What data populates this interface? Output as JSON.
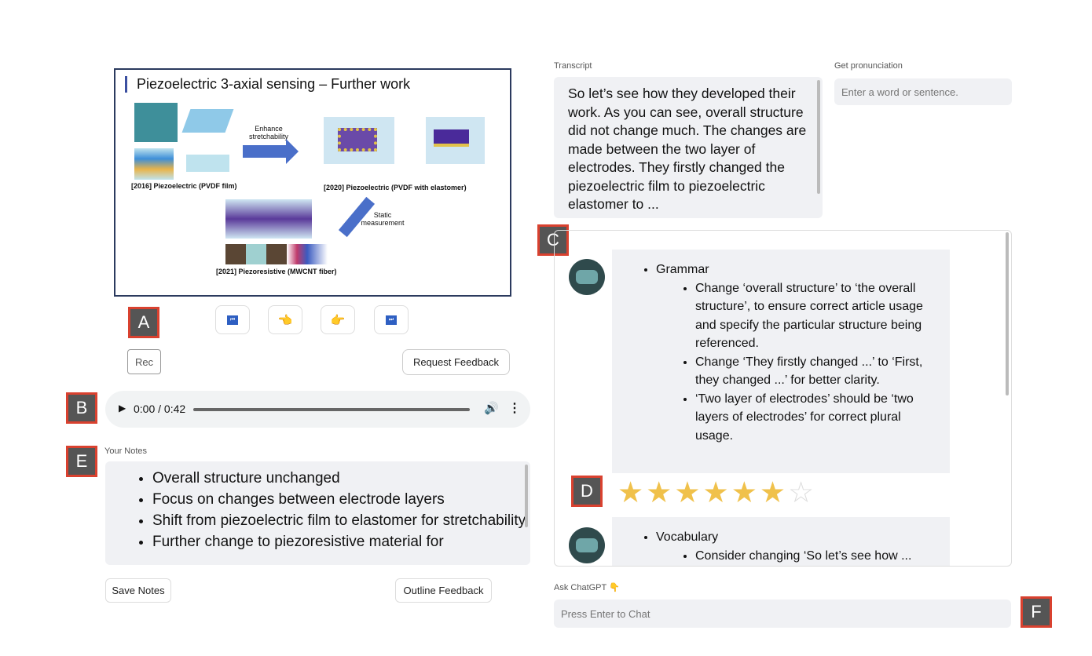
{
  "slide": {
    "title": "Piezoelectric 3-axial sensing – Further work",
    "arrow1": "Enhance stretchability",
    "arrow2": "Static measurement",
    "cap2016": "[2016] Piezoelectric (PVDF film)",
    "cap2020": "[2020] Piezoelectric (PVDF with elastomer)",
    "cap2021": "[2021] Piezoresistive (MWCNT fiber)"
  },
  "labels": {
    "a": "A",
    "b": "B",
    "c": "C",
    "d": "D",
    "e": "E",
    "f": "F"
  },
  "nav": [
    {
      "icon": "first-slide-icon",
      "glyph": "⏮"
    },
    {
      "icon": "pointing-left-icon",
      "glyph": "👈"
    },
    {
      "icon": "pointing-right-icon",
      "glyph": "👉"
    },
    {
      "icon": "last-slide-icon",
      "glyph": "⏭"
    }
  ],
  "rec_label": "Rec",
  "request_feedback_label": "Request Feedback",
  "audio": {
    "time": "0:00 / 0:42",
    "progress": 0
  },
  "notes": {
    "label": "Your Notes",
    "items": [
      "Overall structure unchanged",
      "Focus on changes between electrode layers",
      "Shift from piezoelectric film to elastomer for stretchability",
      "Further change to piezoresistive material for"
    ]
  },
  "save_notes_label": "Save Notes",
  "outline_feedback_label": "Outline Feedback",
  "transcript": {
    "label": "Transcript",
    "text": "So let’s see how they developed their work. As you can see, overall structure did not change much. The changes are made between the two layer of electrodes. They firstly changed the piezoelectric film to piezoelectric elastomer to ..."
  },
  "pronunciation": {
    "label": "Get pronunciation",
    "placeholder": "Enter a word or sentence."
  },
  "feedback": {
    "grammar_title": "Grammar",
    "grammar": [
      "Change ‘overall structure’ to ‘the overall structure’, to ensure correct article usage and specify the particular structure being referenced.",
      "Change ‘They firstly changed ...’ to ‘First, they changed ...’ for better clarity.",
      "‘Two layer of electrodes’ should be ‘two layers of electrodes’ for correct plural usage."
    ],
    "rating": 6,
    "rating_max": 7,
    "star_color": "#f0c14b",
    "vocab_title": "Vocabulary",
    "vocab": [
      "Consider changing ‘So let’s see how ..."
    ]
  },
  "chat": {
    "label": "Ask ChatGPT 👇",
    "placeholder": "Press Enter to Chat"
  }
}
